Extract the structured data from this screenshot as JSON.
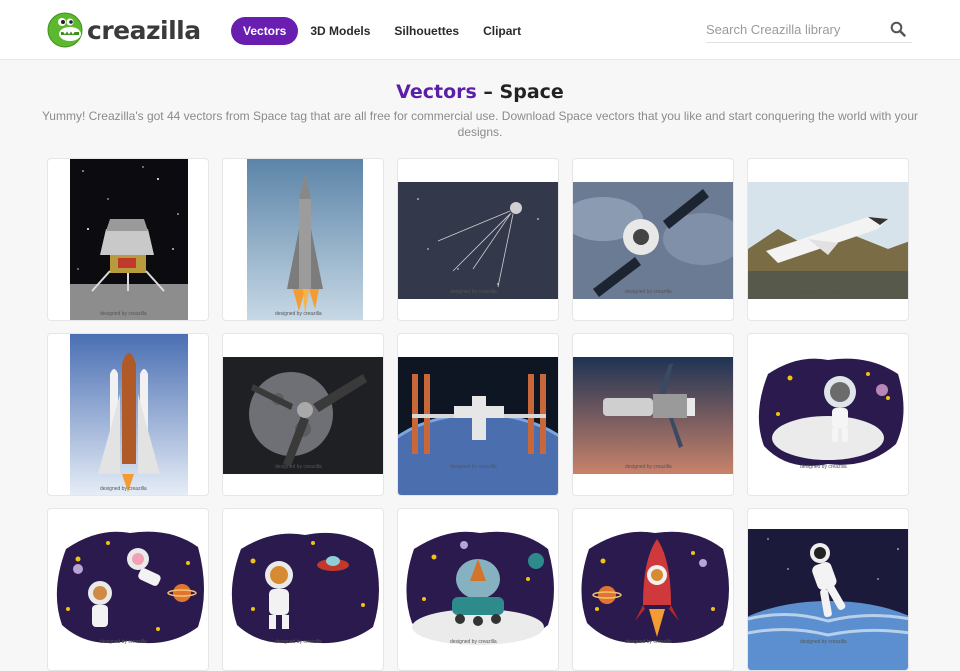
{
  "header": {
    "logo_text": "creazilla",
    "nav": [
      {
        "label": "Vectors",
        "active": true
      },
      {
        "label": "3D Models",
        "active": false
      },
      {
        "label": "Silhouettes",
        "active": false
      },
      {
        "label": "Clipart",
        "active": false
      }
    ],
    "search_placeholder": "Search Creazilla library"
  },
  "main": {
    "title_accent": "Vectors",
    "title_sep": " – ",
    "title_rest": "Space",
    "description": "Yummy! Creazilla's got 44 vectors from Space tag that are all free for commercial use. Download Space vectors that you like and start conquering the world with your designs."
  },
  "watermark": "designed by  creazilla",
  "colors": {
    "accent": "#6a1eb1",
    "title_accent": "#5b1ea6"
  },
  "cards": [
    {
      "name": "lunar-module-card",
      "icon": "lunar-module"
    },
    {
      "name": "rocket-launch-card",
      "icon": "rocket"
    },
    {
      "name": "sputnik-card",
      "icon": "sputnik"
    },
    {
      "name": "dragon-capsule-card",
      "icon": "capsule"
    },
    {
      "name": "space-shuttle-landing-card",
      "icon": "shuttle-landing"
    },
    {
      "name": "space-shuttle-card",
      "icon": "space-shuttle"
    },
    {
      "name": "satellite-moon-card",
      "icon": "satellite"
    },
    {
      "name": "space-station-card",
      "icon": "space-station"
    },
    {
      "name": "hubble-telescope-card",
      "icon": "telescope"
    },
    {
      "name": "raccoon-astronaut-card",
      "icon": "raccoon-astronaut"
    },
    {
      "name": "monkey-astronaut-card",
      "icon": "monkey-astronaut"
    },
    {
      "name": "lion-astronaut-card",
      "icon": "lion-astronaut"
    },
    {
      "name": "fox-rover-card",
      "icon": "fox-rover"
    },
    {
      "name": "lion-rocket-card",
      "icon": "lion-rocket"
    },
    {
      "name": "astronaut-earth-card",
      "icon": "astronaut"
    }
  ]
}
